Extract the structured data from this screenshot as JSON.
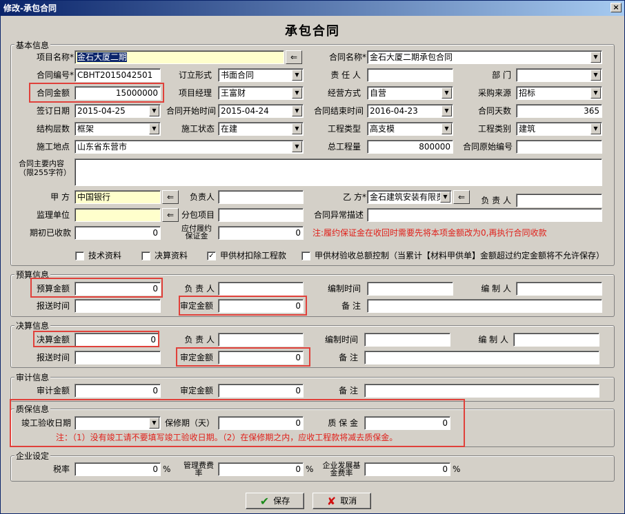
{
  "window": {
    "title": "修改-承包合同",
    "close": "×"
  },
  "form_title": "承包合同",
  "groups": {
    "basic": "基本信息",
    "budget": "预算信息",
    "final": "决算信息",
    "audit": "审计信息",
    "warranty": "质保信息",
    "enterprise": "企业设定"
  },
  "basic": {
    "project_name_label": "项目名称*",
    "project_name": "金石大厦二期",
    "contract_name_label": "合同名称*",
    "contract_name": "金石大厦二期承包合同",
    "contract_no_label": "合同编号*",
    "contract_no": "CBHT2015042501",
    "sign_form_label": "订立形式",
    "sign_form": "书面合同",
    "owner_label": "责 任 人",
    "owner": "",
    "dept_label": "部    门",
    "dept": "",
    "amount_label": "合同金额",
    "amount": "15000000",
    "pm_label": "项目经理",
    "pm": "王富财",
    "mode_label": "经营方式",
    "mode": "自营",
    "source_label": "采购来源",
    "source": "招标",
    "sign_date_label": "签订日期",
    "sign_date": "2015-04-25",
    "start_label": "合同开始时间",
    "start": "2015-04-24",
    "end_label": "合同结束时间",
    "end": "2016-04-23",
    "days_label": "合同天数",
    "days": "365",
    "structure_label": "结构层数",
    "structure": "框架",
    "status_label": "施工状态",
    "status": "在建",
    "ptype_label": "工程类型",
    "ptype": "高支模",
    "pcat_label": "工程类别",
    "pcat": "建筑",
    "site_label": "施工地点",
    "site": "山东省东营市",
    "qty_label": "总工程量",
    "qty": "800000",
    "orig_no_label": "合同原始编号",
    "orig_no": "",
    "content_label": "合同主要内容（限255字符）",
    "content": "",
    "party_a_label": "甲    方",
    "party_a": "中国银行",
    "a_owner_label": "负责人",
    "a_owner": "",
    "party_b_label": "乙    方*",
    "party_b": "金石建筑安装有限责",
    "b_owner_label": "负 责 人",
    "b_owner": "",
    "supervisor_label": "监理单位",
    "supervisor": "",
    "sub_label": "分包项目",
    "sub": "",
    "abnormal_label": "合同异常描述",
    "abnormal": "",
    "init_recv_label": "期初已收款",
    "init_recv": "0",
    "deposit_label": "应付履约保证金",
    "deposit": "0",
    "deposit_note": "注:履约保证金在收回时需要先将本项金额改为0,再执行合同收款",
    "checks": [
      {
        "label": "技术资料",
        "checked": ""
      },
      {
        "label": "决算资料",
        "checked": ""
      },
      {
        "label": "甲供材扣除工程款",
        "checked": "✓"
      },
      {
        "label": "甲供材验收总额控制（当累计【材料甲供单】金额超过约定金额将不允许保存）",
        "checked": ""
      }
    ]
  },
  "budget": {
    "amount_label": "预算金额",
    "amount": "0",
    "owner_label": "负 责 人",
    "owner": "",
    "time_label": "编制时间",
    "time": "",
    "maker_label": "编 制 人",
    "maker": "",
    "send_label": "报送时间",
    "send": "",
    "approved_label": "审定金额",
    "approved": "0",
    "remark_label": "备    注",
    "remark": ""
  },
  "final": {
    "amount_label": "决算金额",
    "amount": "0",
    "owner_label": "负 责 人",
    "owner": "",
    "time_label": "编制时间",
    "time": "",
    "maker_label": "编 制 人",
    "maker": "",
    "send_label": "报送时间",
    "send": "",
    "approved_label": "审定金额",
    "approved": "0",
    "remark_label": "备    注",
    "remark": ""
  },
  "audit": {
    "amount_label": "审计金额",
    "amount": "0",
    "approved_label": "审定金额",
    "approved": "0",
    "remark_label": "备    注",
    "remark": ""
  },
  "warranty": {
    "date_label": "竣工验收日期",
    "date": "",
    "period_label": "保修期（天）",
    "period": "0",
    "deposit_label": "质 保 金",
    "deposit": "0",
    "note": "注：（1）没有竣工请不要填写竣工验收日期。（2）在保修期之内，应收工程款将减去质保金。"
  },
  "enterprise": {
    "tax_label": "税率",
    "tax": "0",
    "mgmt_label": "管理费费率",
    "mgmt": "0",
    "dev_label": "企业发展基金费率",
    "dev": "0",
    "pct": "%"
  },
  "buttons": {
    "save": "保存",
    "cancel": "取消"
  },
  "colors": {
    "highlight_border": "#e0403a",
    "note_text": "#e0201a",
    "required_bg": "#ffffcc",
    "titlebar": "#0a246a"
  }
}
